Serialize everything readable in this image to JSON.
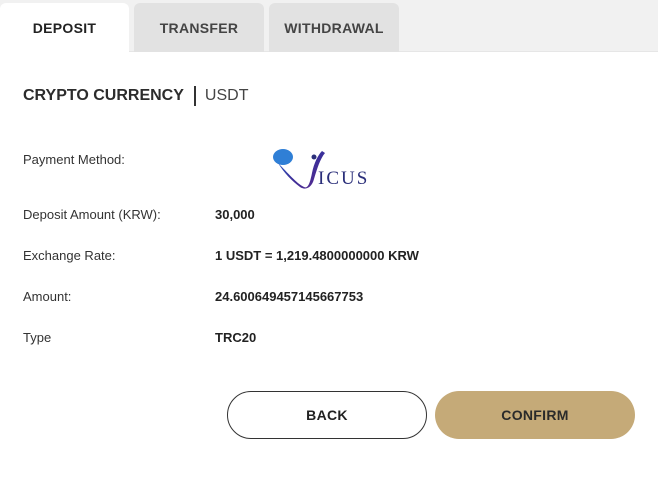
{
  "tabs": [
    {
      "label": "DEPOSIT",
      "active": true
    },
    {
      "label": "TRANSFER",
      "active": false
    },
    {
      "label": "WITHDRAWAL",
      "active": false
    }
  ],
  "heading": {
    "main": "CRYPTO CURRENCY",
    "sub": "USDT"
  },
  "details": {
    "payment_method_label": "Payment Method:",
    "payment_method_logo_text": "ICUS",
    "deposit_amount_label": "Deposit Amount (KRW):",
    "deposit_amount_value": "30,000",
    "exchange_rate_label": "Exchange Rate:",
    "exchange_rate_value": "1 USDT = 1,219.4800000000 KRW",
    "amount_label": "Amount:",
    "amount_value": "24.600649457145667753",
    "type_label": "Type",
    "type_value": "TRC20"
  },
  "buttons": {
    "back": "BACK",
    "confirm": "CONFIRM"
  },
  "colors": {
    "accent": "#c5aa78",
    "logo": "#2b2f7a",
    "tab_inactive": "#e2e2e2"
  }
}
